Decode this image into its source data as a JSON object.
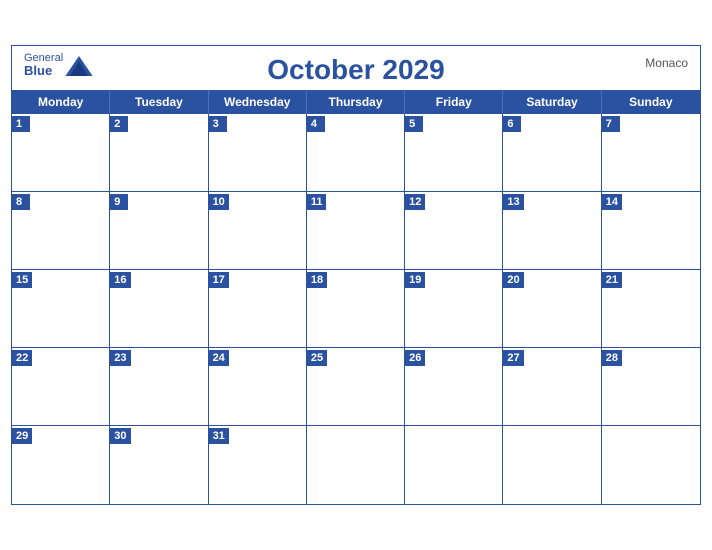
{
  "header": {
    "logo_general": "General",
    "logo_blue": "Blue",
    "month_title": "October 2029",
    "country": "Monaco"
  },
  "days": {
    "headers": [
      "Monday",
      "Tuesday",
      "Wednesday",
      "Thursday",
      "Friday",
      "Saturday",
      "Sunday"
    ]
  },
  "weeks": [
    [
      1,
      2,
      3,
      4,
      5,
      6,
      7
    ],
    [
      8,
      9,
      10,
      11,
      12,
      13,
      14
    ],
    [
      15,
      16,
      17,
      18,
      19,
      20,
      21
    ],
    [
      22,
      23,
      24,
      25,
      26,
      27,
      28
    ],
    [
      29,
      30,
      31,
      null,
      null,
      null,
      null
    ]
  ]
}
